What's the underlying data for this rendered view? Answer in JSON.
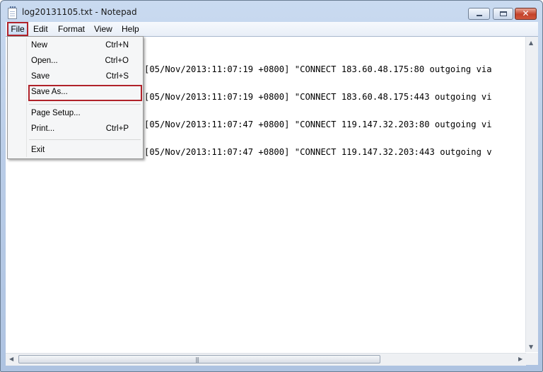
{
  "window": {
    "title": "log20131105.txt - Notepad",
    "close_glyph": "✕"
  },
  "menubar": {
    "items": [
      "File",
      "Edit",
      "Format",
      "View",
      "Help"
    ]
  },
  "file_menu": {
    "items": [
      {
        "label": "New",
        "shortcut": "Ctrl+N"
      },
      {
        "label": "Open...",
        "shortcut": "Ctrl+O"
      },
      {
        "label": "Save",
        "shortcut": "Ctrl+S"
      },
      {
        "label": "Save As...",
        "shortcut": ""
      },
      {
        "label": "Page Setup...",
        "shortcut": ""
      },
      {
        "label": "Print...",
        "shortcut": "Ctrl+P"
      },
      {
        "label": "Exit",
        "shortcut": ""
      }
    ]
  },
  "editor": {
    "lines": [
      "[05/Nov/2013:11:07:19 +0800] \"CONNECT 183.60.48.175:80 outgoing via",
      "[05/Nov/2013:11:07:19 +0800] \"CONNECT 183.60.48.175:443 outgoing vi",
      "[05/Nov/2013:11:07:47 +0800] \"CONNECT 119.147.32.203:80 outgoing vi",
      "[05/Nov/2013:11:07:47 +0800] \"CONNECT 119.147.32.203:443 outgoing v"
    ]
  },
  "scrollbars": {
    "up": "▲",
    "down": "▼",
    "left": "◀",
    "right": "▶",
    "grip": "|||"
  },
  "colors": {
    "highlight_border": "#b0222a",
    "title_gradient": "#b9cce7"
  }
}
